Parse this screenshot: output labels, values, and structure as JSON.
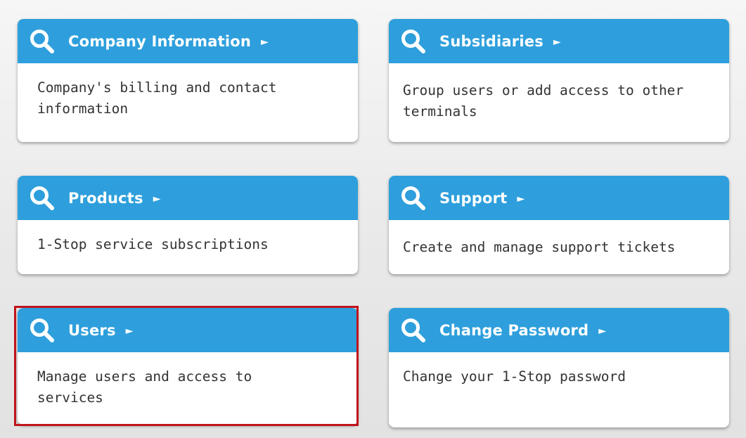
{
  "cards": [
    {
      "title": "Company Information",
      "description": "Company's billing and contact information",
      "icon": "search-icon"
    },
    {
      "title": "Subsidiaries",
      "description": "Group users or add access to other terminals",
      "icon": "search-icon"
    },
    {
      "title": "Products",
      "description": "1-Stop service subscriptions",
      "icon": "search-icon"
    },
    {
      "title": "Support",
      "description": "Create and manage support tickets",
      "icon": "search-icon"
    },
    {
      "title": "Users",
      "description": "Manage users and access to services",
      "icon": "search-icon"
    },
    {
      "title": "Change Password",
      "description": "Change your 1-Stop password",
      "icon": "search-icon"
    }
  ],
  "colors": {
    "header": "#2e9fdc",
    "selected_outline": "#c0141b",
    "body_text": "#333333"
  }
}
